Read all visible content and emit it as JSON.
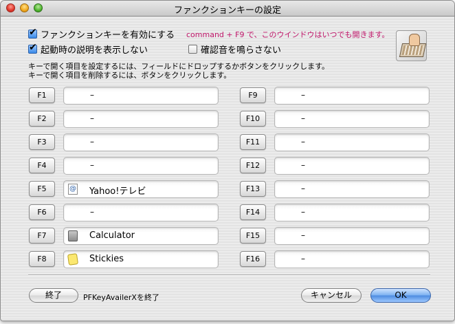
{
  "window": {
    "title": "ファンクションキーの設定"
  },
  "options": {
    "enable_fkeys": {
      "label": "ファンクションキーを有効にする",
      "checked": true
    },
    "hide_startup": {
      "label": "起動時の説明を表示しない",
      "checked": true
    },
    "confirm_sound": {
      "label": "確認音を鳴らさない",
      "checked": false
    }
  },
  "hint": "command + F9 で、このウインドウはいつでも開きます。",
  "instructions": {
    "line1": "キーで開く項目を設定するには、フィールドにドロップするかボタンをクリックします。",
    "line2": "キーで開く項目を削除するには、ボタンをクリックします。"
  },
  "left_keys": [
    {
      "key": "F1",
      "item": "–",
      "icon": null
    },
    {
      "key": "F2",
      "item": "–",
      "icon": null
    },
    {
      "key": "F3",
      "item": "–",
      "icon": null
    },
    {
      "key": "F4",
      "item": "–",
      "icon": null
    },
    {
      "key": "F5",
      "item": "Yahoo!テレビ",
      "icon": "web-location-icon"
    },
    {
      "key": "F6",
      "item": "–",
      "icon": null
    },
    {
      "key": "F7",
      "item": "Calculator",
      "icon": "calculator-app-icon"
    },
    {
      "key": "F8",
      "item": "Stickies",
      "icon": "stickies-app-icon"
    }
  ],
  "right_keys": [
    {
      "key": "F9",
      "item": "–"
    },
    {
      "key": "F10",
      "item": "–"
    },
    {
      "key": "F11",
      "item": "–"
    },
    {
      "key": "F12",
      "item": "–"
    },
    {
      "key": "F13",
      "item": "–"
    },
    {
      "key": "F14",
      "item": "–"
    },
    {
      "key": "F15",
      "item": "–"
    },
    {
      "key": "F16",
      "item": "–"
    }
  ],
  "footer": {
    "quit_button": "終了",
    "quit_label": "PFKeyAvailerXを終了",
    "cancel_button": "キャンセル",
    "ok_button": "OK"
  },
  "colors": {
    "hint": "#c0166a",
    "ok_accent": "#4c8be0"
  }
}
